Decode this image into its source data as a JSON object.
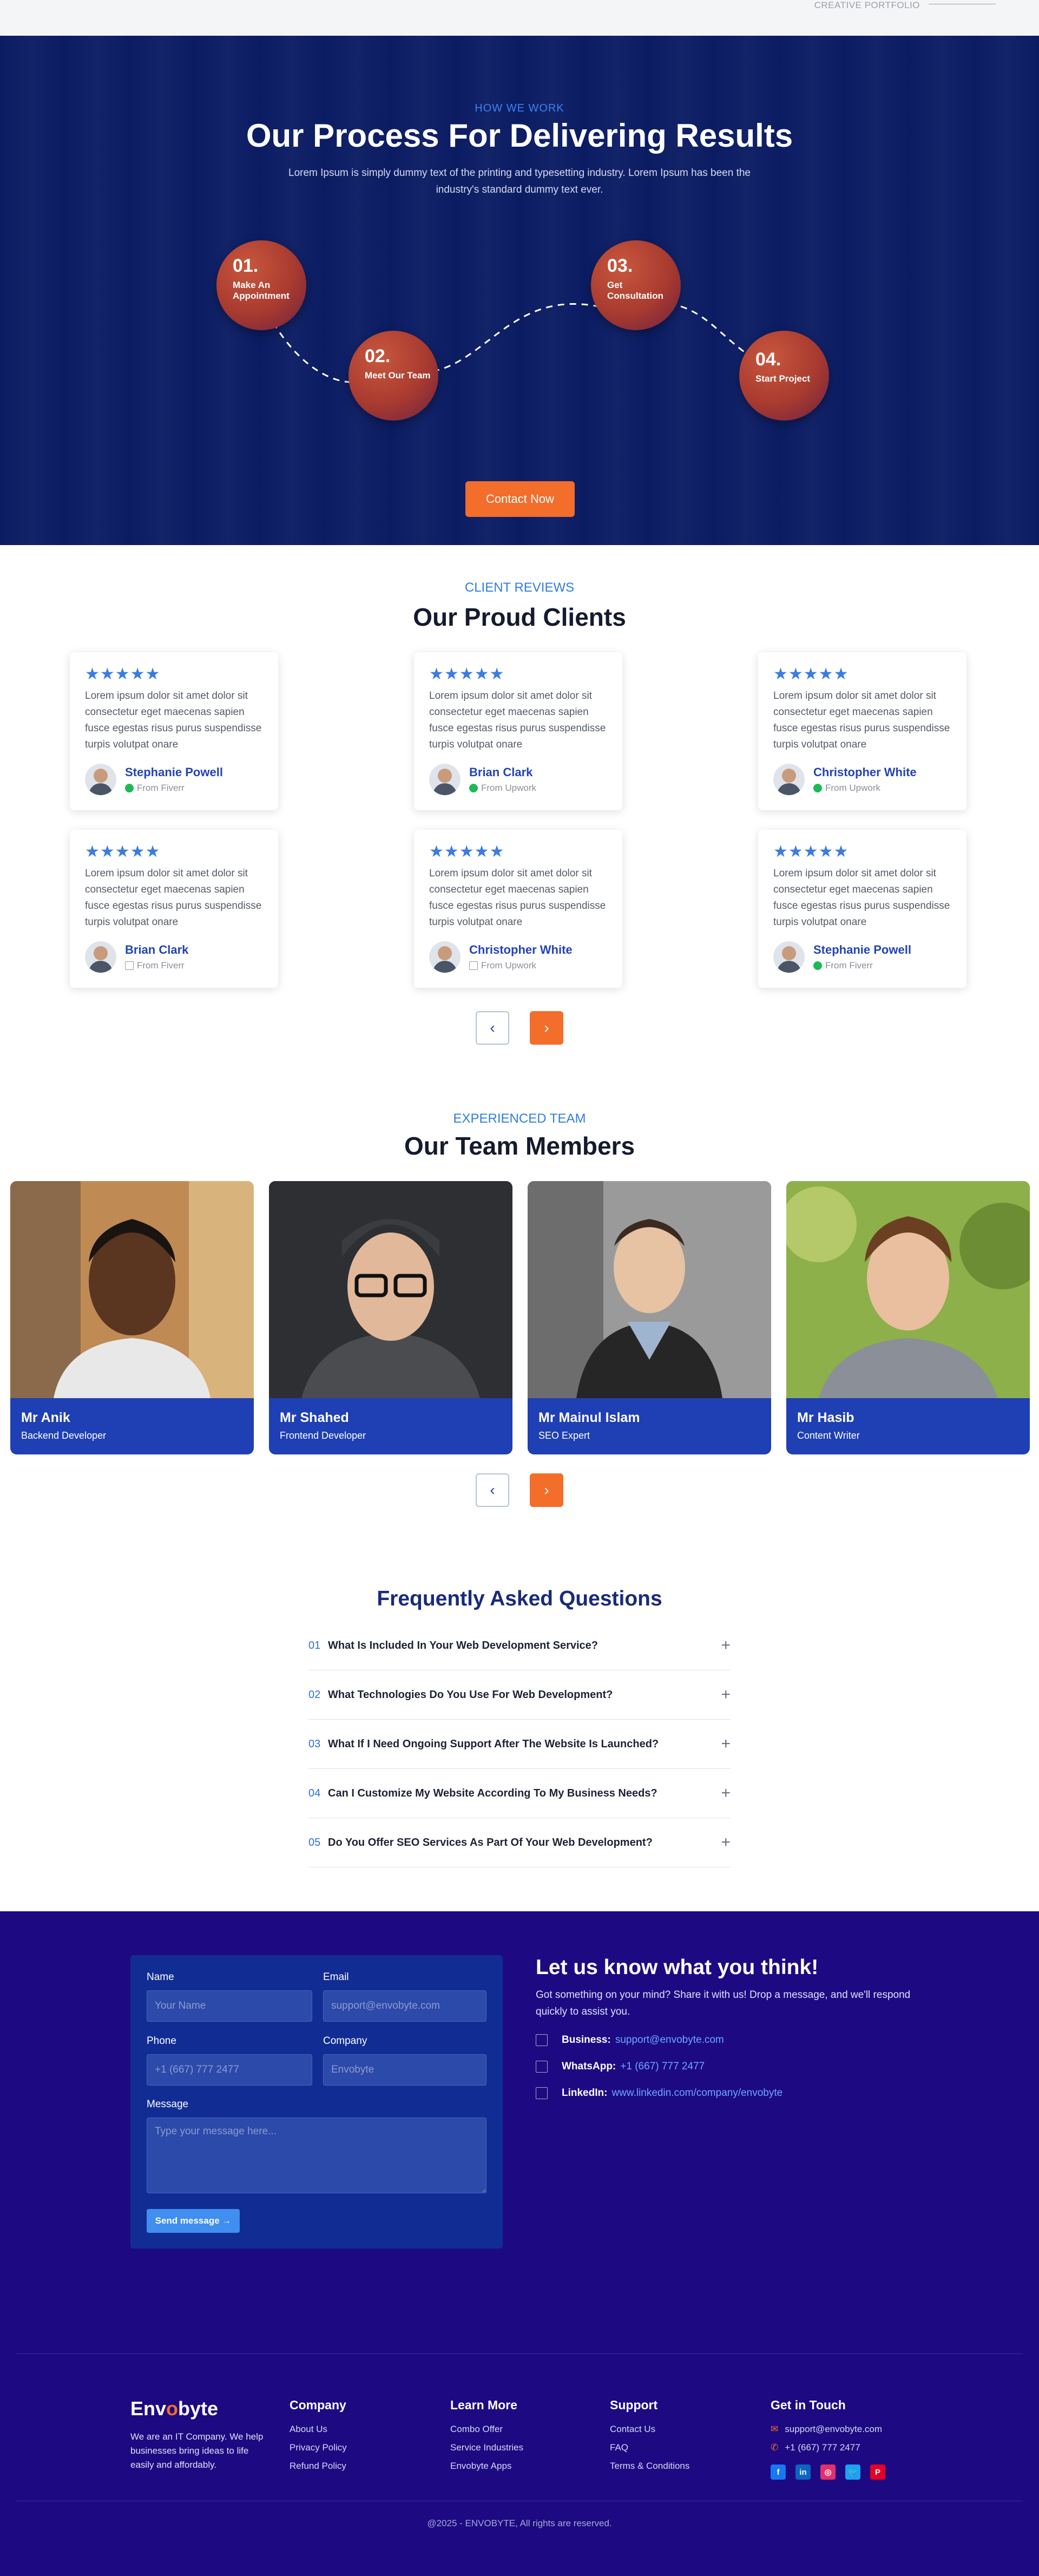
{
  "topstrip": {
    "label": "CREATIVE PORTFOLIO"
  },
  "process": {
    "eyebrow": "HOW WE WORK",
    "title": "Our Process For Delivering Results",
    "subtitle": "Lorem Ipsum is simply dummy text of the printing and typesetting industry. Lorem Ipsum has been the industry's standard dummy text ever.",
    "steps": [
      {
        "num": "01.",
        "label": "Make An Appointment"
      },
      {
        "num": "02.",
        "label": "Meet Our Team"
      },
      {
        "num": "03.",
        "label": "Get Consultation"
      },
      {
        "num": "04.",
        "label": "Start Project"
      }
    ],
    "cta": "Contact Now"
  },
  "reviews": {
    "eyebrow": "CLIENT REVIEWS",
    "title": "Our Proud Clients",
    "stars": "★★★★★",
    "cards": [
      {
        "text": "Lorem ipsum dolor sit amet dolor sit consectetur eget maecenas sapien fusce egestas risus purus suspendisse turpis volutpat onare",
        "name": "Stephanie Powell",
        "source": "From Fiverr"
      },
      {
        "text": "Lorem ipsum dolor sit amet dolor sit consectetur eget maecenas sapien fusce egestas risus purus suspendisse turpis volutpat onare",
        "name": "Brian Clark",
        "source": "From Upwork"
      },
      {
        "text": "Lorem ipsum dolor sit amet dolor sit consectetur eget maecenas sapien fusce egestas risus purus suspendisse turpis volutpat onare",
        "name": "Christopher White",
        "source": "From Upwork"
      },
      {
        "text": "Lorem ipsum dolor sit amet dolor sit consectetur eget maecenas sapien fusce egestas risus purus suspendisse turpis volutpat onare",
        "name": "Brian Clark",
        "source": "From Fiverr"
      },
      {
        "text": "Lorem ipsum dolor sit amet dolor sit consectetur eget maecenas sapien fusce egestas risus purus suspendisse turpis volutpat onare",
        "name": "Christopher White",
        "source": "From Upwork"
      },
      {
        "text": "Lorem ipsum dolor sit amet dolor sit consectetur eget maecenas sapien fusce egestas risus purus suspendisse turpis volutpat onare",
        "name": "Stephanie Powell",
        "source": "From Fiverr"
      }
    ],
    "prev": "‹",
    "next": "›"
  },
  "team": {
    "eyebrow": "EXPERIENCED TEAM",
    "title": "Our Team Members",
    "members": [
      {
        "name": "Mr Anik",
        "role": "Backend Developer"
      },
      {
        "name": "Mr Shahed",
        "role": "Frontend Developer"
      },
      {
        "name": "Mr Mainul Islam",
        "role": "SEO Expert"
      },
      {
        "name": "Mr Hasib",
        "role": "Content Writer"
      }
    ],
    "prev": "‹",
    "next": "›"
  },
  "faq": {
    "title": "Frequently Asked Questions",
    "items": [
      {
        "no": "01",
        "q": "What Is Included In Your Web Development Service?"
      },
      {
        "no": "02",
        "q": "What Technologies Do You Use For Web Development?"
      },
      {
        "no": "03",
        "q": "What If I Need Ongoing Support After The Website Is Launched?"
      },
      {
        "no": "04",
        "q": "Can I Customize My Website According To My Business Needs?"
      },
      {
        "no": "05",
        "q": "Do You Offer SEO Services As Part Of Your Web Development?"
      }
    ],
    "plus": "+"
  },
  "contact": {
    "form": {
      "name_label": "Name",
      "name_placeholder": "Your Name",
      "email_label": "Email",
      "email_placeholder": "support@envobyte.com",
      "phone_label": "Phone",
      "phone_placeholder": "+1 (667) 777 2477",
      "company_label": "Company",
      "company_placeholder": "Envobyte",
      "message_label": "Message",
      "message_placeholder": "Type your message here...",
      "send": "Send message →"
    },
    "title": "Let us know what you think!",
    "desc": "Got something on your mind? Share it with us! Drop a message, and we'll respond quickly to assist you.",
    "rows": [
      {
        "label": "Business:",
        "value": "support@envobyte.com"
      },
      {
        "label": "WhatsApp:",
        "value": "+1 (667) 777 2477"
      },
      {
        "label": "LinkedIn:",
        "value": "www.linkedin.com/company/envobyte"
      }
    ]
  },
  "footer": {
    "logo_a": "Env",
    "logo_b": "o",
    "logo_c": "byte",
    "about": "We are an IT Company. We help businesses bring ideas to life easily and affordably.",
    "columns": [
      {
        "title": "Company",
        "links": [
          "About Us",
          "Privacy Policy",
          "Refund Policy"
        ]
      },
      {
        "title": "Learn More",
        "links": [
          "Combo Offer",
          "Service Industries",
          "Envobyte Apps"
        ]
      },
      {
        "title": "Support",
        "links": [
          "Contact Us",
          "FAQ",
          "Terms & Conditions"
        ]
      }
    ],
    "touch": {
      "title": "Get in Touch",
      "email": "support@envobyte.com",
      "phone": "+1 (667) 777 2477"
    },
    "social": [
      {
        "icon": "facebook-icon",
        "glyph": "f",
        "color": "#1877f2"
      },
      {
        "icon": "linkedin-icon",
        "glyph": "in",
        "color": "#0a66c2"
      },
      {
        "icon": "instagram-icon",
        "glyph": "◎",
        "color": "#e1306c"
      },
      {
        "icon": "twitter-icon",
        "glyph": "🐦",
        "color": "#1da1f2"
      },
      {
        "icon": "pinterest-icon",
        "glyph": "P",
        "color": "#e60023"
      }
    ],
    "copyright": "@2025 - ENVOBYTE, All rights are reserved."
  }
}
